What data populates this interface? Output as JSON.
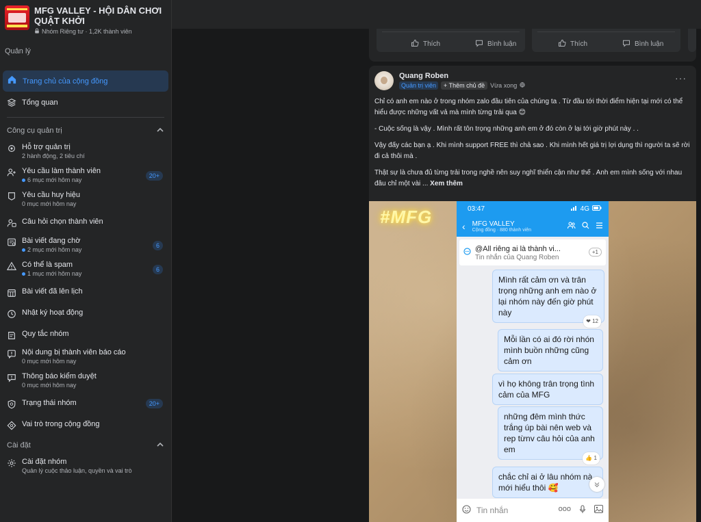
{
  "group": {
    "title": "MFG VALLEY - HỘI DÂN CHƠI QUẬT KHỞI",
    "privacy_members": "Nhóm Riêng tư · 1,2K thành viên"
  },
  "sidebar": {
    "manage_label": "Quản lý",
    "home": "Trang chủ của cộng đồng",
    "overview": "Tổng quan",
    "admin_tools_label": "Công cụ quản trị",
    "tools": [
      {
        "title": "Hỗ trợ quản trị",
        "sub": "2 hành động, 2 tiêu chí"
      },
      {
        "title": "Yêu cầu làm thành viên",
        "sub": "6 mục mới hôm nay",
        "badge": "20+"
      },
      {
        "title": "Yêu cầu huy hiệu",
        "sub": "0 mục mới hôm nay"
      },
      {
        "title": "Câu hỏi chọn thành viên",
        "sub": ""
      },
      {
        "title": "Bài viết đang chờ",
        "sub": "2 mục mới hôm nay",
        "badge": "6"
      },
      {
        "title": "Có thể là spam",
        "sub": "1 mục mới hôm nay",
        "badge": "6"
      },
      {
        "title": "Bài viết đã lên lịch",
        "sub": ""
      },
      {
        "title": "Nhật ký hoạt động",
        "sub": ""
      },
      {
        "title": "Quy tắc nhóm",
        "sub": ""
      },
      {
        "title": "Nội dung bị thành viên báo cáo",
        "sub": "0 mục mới hôm nay"
      },
      {
        "title": "Thông báo kiểm duyệt",
        "sub": "0 mục mới hôm nay"
      },
      {
        "title": "Trạng thái nhóm",
        "sub": "",
        "badge": "20+"
      },
      {
        "title": "Vai trò trong cộng đồng",
        "sub": ""
      }
    ],
    "settings_label": "Cài đặt",
    "settings_item": {
      "title": "Cài đặt nhóm",
      "sub": "Quản lý cuộc thảo luận, quyền và vai trò"
    }
  },
  "prev_post": {
    "like": "Thích",
    "comment": "Bình luận"
  },
  "post": {
    "author": "Quang Roben",
    "role": "Quản trị viên",
    "add_topic": "+ Thêm chủ đề",
    "time": "Vừa xong",
    "more": "···",
    "paragraphs": [
      "Chỉ có anh em nào ở trong nhóm zalo đầu tiên của chúng ta . Từ đầu tới thời điểm hiện tại mới có thể hiểu được những vất vả mà mình từng trải qua 😊",
      "- Cuộc sống là vậy . Mình rất tôn trọng những anh em ở đó còn ở lại tới giờ phút này . .",
      "Vậy đấy các bạn ạ . Khi mình support FREE thì chả sao . Khi mình hết giá trị lợi dụng thì người ta sẽ rời đi cả thôi mà ."
    ],
    "last_paragraph": "Thật sự là chưa đủ từng trải trong nghề nên suy nghĩ thiển cận như thế . Anh em mình sống với nhau đâu chỉ một vài ...",
    "see_more": "Xem thêm"
  },
  "image": {
    "neon_text": "#MFG",
    "phone": {
      "time": "03:47",
      "signal": "4G",
      "chat_name": "MFG VALLEY",
      "chat_sub": "Cộng đồng · 880 thành viên",
      "pinned_title": "@All  riêng ai là thành vi...",
      "pinned_sub": "Tin nhắn của Quang Roben",
      "pinned_badge": "+1",
      "messages": [
        {
          "text": "Mình rất cảm ơn và trân trọng những anh em nào ở lại nhóm này đến giờ phút này",
          "reaction": "❤ 12"
        },
        {
          "text": "Mỗi lần có ai đó rời nhón mình buồn những cũng cảm ơn",
          "reaction": ""
        },
        {
          "text": "vì họ không trân trọng tình cảm của MFG",
          "reaction": ""
        },
        {
          "text": "những đêm mình thức trắng úp bài nên web và rep từnv câu hỏi của anh em",
          "reaction": "👍 1"
        },
        {
          "text": "chắc chỉ ai ở lâu nhóm nà mới hiểu thôi 🥰",
          "reaction": ""
        }
      ],
      "composer_placeholder": "Tin nhắn"
    }
  }
}
